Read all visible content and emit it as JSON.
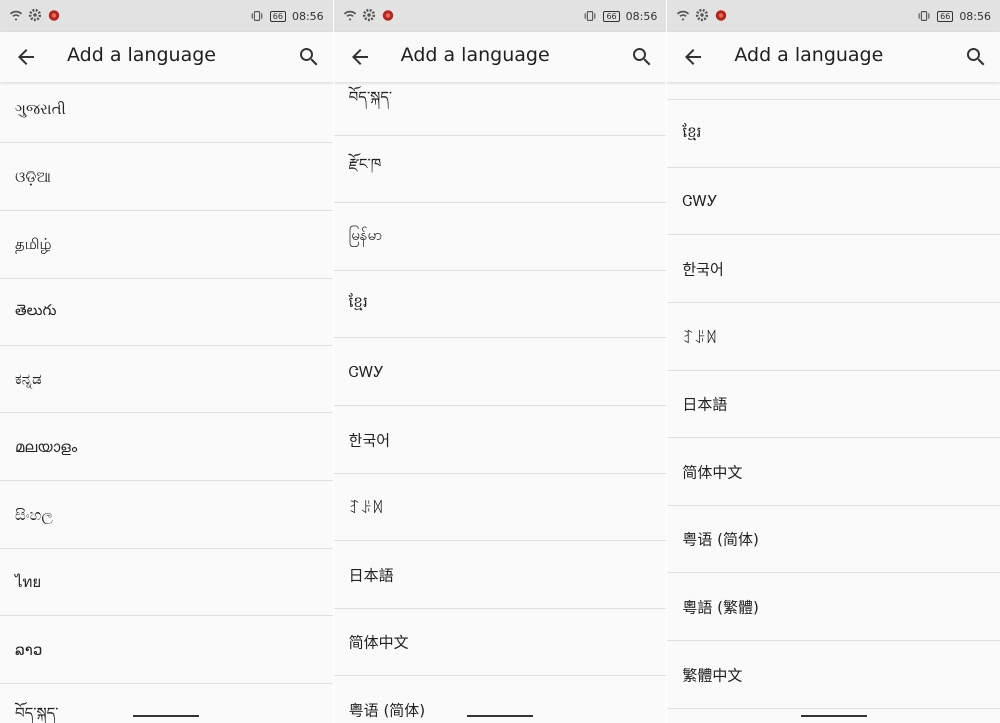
{
  "status": {
    "time": "08:56",
    "battery": "66"
  },
  "appbar": {
    "title": "Add a language"
  },
  "screens": [
    {
      "items": [
        "ગુજરાતી",
        "ଓଡ଼ିଆ",
        "தமிழ்",
        "తెలుగు",
        "ಕನ್ನಡ",
        "മലയാളം",
        "සිංහල",
        "ไทย",
        "ລາວ",
        "བོད་སྐད་"
      ]
    },
    {
      "items": [
        "བོད་སྐད་",
        "རྫོང་ཁ",
        "မြန်မာ",
        "ខ្មែរ",
        "ᏣᎳᎩ",
        "한국어",
        "ꆈꌠꉙ",
        "日本語",
        "简体中文",
        "粤语 (简体)"
      ]
    },
    {
      "items": [
        "",
        "ខ្មែរ",
        "ᏣᎳᎩ",
        "한국어",
        "ꆈꌠꉙ",
        "日本語",
        "简体中文",
        "粤语 (简体)",
        "粵語 (繁體)",
        "繁體中文"
      ]
    }
  ]
}
